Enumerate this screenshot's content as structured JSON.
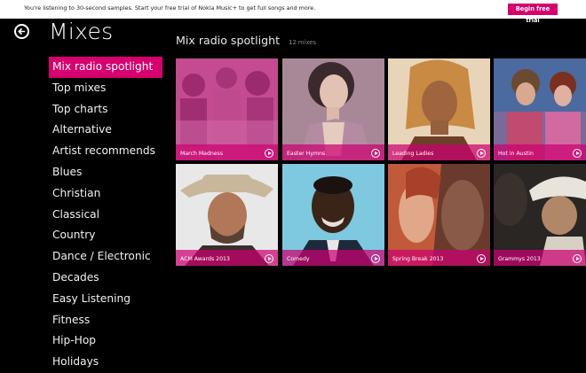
{
  "banner": {
    "message": "You're listening to 30-second samples. Start your free trial of Nokia Music+ to get full songs and more.",
    "button_label": "Begin free trial"
  },
  "page": {
    "title": "Mixes"
  },
  "section": {
    "title": "Mix radio spotlight",
    "count": "12 mixes"
  },
  "sidebar": {
    "items": [
      {
        "label": "Mix radio spotlight",
        "selected": true
      },
      {
        "label": "Top mixes"
      },
      {
        "label": "Top charts"
      },
      {
        "label": "Alternative"
      },
      {
        "label": "Artist recommends"
      },
      {
        "label": "Blues"
      },
      {
        "label": "Christian"
      },
      {
        "label": "Classical"
      },
      {
        "label": "Country"
      },
      {
        "label": "Dance / Electronic"
      },
      {
        "label": "Decades"
      },
      {
        "label": "Easy Listening"
      },
      {
        "label": "Fitness"
      },
      {
        "label": "Hip-Hop"
      },
      {
        "label": "Holidays"
      }
    ]
  },
  "tiles": [
    {
      "label": "March Madness"
    },
    {
      "label": "Easter Hymns"
    },
    {
      "label": "Leading Ladies"
    },
    {
      "label": "Hot in Austin"
    },
    {
      "label": "ACM Awards 2013"
    },
    {
      "label": "Comedy"
    },
    {
      "label": "Spring Break 2013"
    },
    {
      "label": "Grammys 2013"
    }
  ],
  "colors": {
    "accent": "#d6006f",
    "background": "#000000"
  },
  "icons": {
    "back": "back-arrow-icon",
    "play": "play-icon"
  }
}
